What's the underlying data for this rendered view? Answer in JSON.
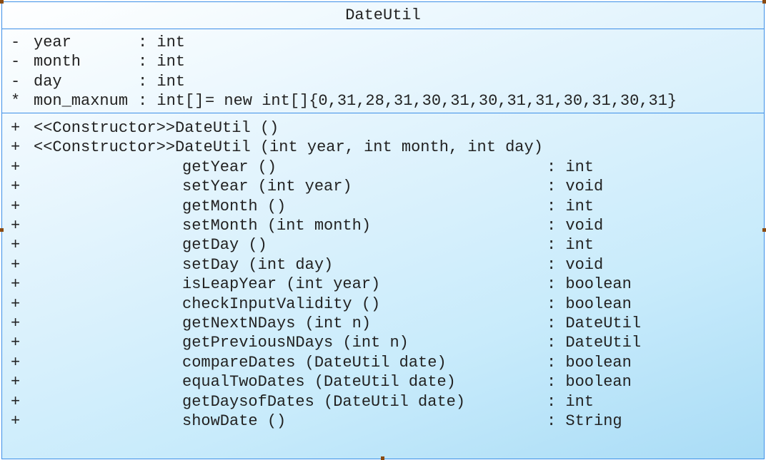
{
  "class_name": "DateUtil",
  "attributes": [
    {
      "vis": "-",
      "name": "year",
      "type": "int",
      "init": ""
    },
    {
      "vis": "-",
      "name": "month",
      "type": "int",
      "init": ""
    },
    {
      "vis": "-",
      "name": "day",
      "type": "int",
      "init": ""
    },
    {
      "vis": "*",
      "name": "mon_maxnum",
      "type": "int[]",
      "init": "= new int[]{0,31,28,31,30,31,30,31,31,30,31,30,31}"
    }
  ],
  "constructors": [
    {
      "vis": "+",
      "sig": "<<Constructor>>DateUtil ()"
    },
    {
      "vis": "+",
      "sig": "<<Constructor>>DateUtil (int year, int month, int day)"
    }
  ],
  "methods": [
    {
      "vis": "+",
      "sig": "getYear ()",
      "ret": ": int"
    },
    {
      "vis": "+",
      "sig": "setYear (int year)",
      "ret": ": void"
    },
    {
      "vis": "+",
      "sig": "getMonth ()",
      "ret": ": int"
    },
    {
      "vis": "+",
      "sig": "setMonth (int month)",
      "ret": ": void"
    },
    {
      "vis": "+",
      "sig": "getDay ()",
      "ret": ": int"
    },
    {
      "vis": "+",
      "sig": "setDay (int day)",
      "ret": ": void"
    },
    {
      "vis": "+",
      "sig": "isLeapYear (int year)",
      "ret": ": boolean"
    },
    {
      "vis": "+",
      "sig": "checkInputValidity ()",
      "ret": ": boolean"
    },
    {
      "vis": "+",
      "sig": "getNextNDays (int n)",
      "ret": ": DateUtil"
    },
    {
      "vis": "+",
      "sig": "getPreviousNDays (int n)",
      "ret": ": DateUtil"
    },
    {
      "vis": "+",
      "sig": "compareDates (DateUtil date)",
      "ret": ": boolean"
    },
    {
      "vis": "+",
      "sig": "equalTwoDates (DateUtil date)",
      "ret": ": boolean"
    },
    {
      "vis": "+",
      "sig": "getDaysofDates (DateUtil date)",
      "ret": ": int"
    },
    {
      "vis": "+",
      "sig": "showDate ()",
      "ret": ": String"
    }
  ]
}
